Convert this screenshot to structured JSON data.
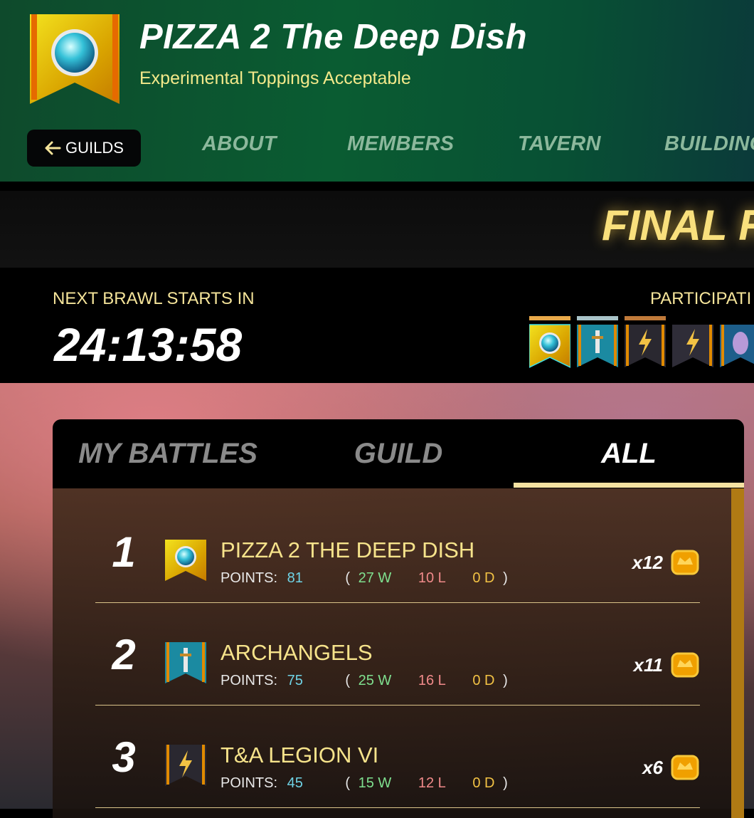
{
  "header": {
    "guild_name": "PIZZA 2 The Deep Dish",
    "motto": "Experimental Toppings Acceptable",
    "back_label": "GUILDS",
    "nav_tabs": [
      "ABOUT",
      "MEMBERS",
      "TAVERN",
      "BUILDING"
    ]
  },
  "final_bar": {
    "text": "FINAL R"
  },
  "status": {
    "next_brawl_label": "NEXT BRAWL STARTS IN",
    "countdown": "24:13:58",
    "participants_label": "PARTICIPATI"
  },
  "panel": {
    "tabs": [
      "MY BATTLES",
      "GUILD",
      "ALL"
    ],
    "active_tab": "ALL",
    "points_label": "POINTS:",
    "rows": [
      {
        "rank": "1",
        "name": "PIZZA 2 THE DEEP DISH",
        "points": "81",
        "wins": "27 W",
        "losses": "10 L",
        "draws": "0 D",
        "multiplier": "x12",
        "icon": "orb-icon"
      },
      {
        "rank": "2",
        "name": "ARCHANGELS",
        "points": "75",
        "wins": "25 W",
        "losses": "16 L",
        "draws": "0 D",
        "multiplier": "x11",
        "icon": "sword-icon"
      },
      {
        "rank": "3",
        "name": "T&A LEGION VI",
        "points": "45",
        "wins": "15 W",
        "losses": "12 L",
        "draws": "0 D",
        "multiplier": "x6",
        "icon": "lightning-icon"
      }
    ]
  },
  "colors": {
    "accent_gold": "#f6e38b",
    "points_cyan": "#6fd3e6",
    "wins_green": "#7fe08f",
    "losses_red": "#f08a8a",
    "draws_gold": "#f2c244"
  }
}
